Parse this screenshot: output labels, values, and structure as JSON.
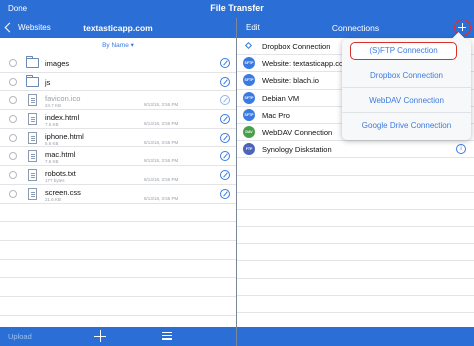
{
  "app": {
    "done_label": "Done",
    "title": "File Transfer"
  },
  "left_nav": {
    "back_label": "Websites",
    "site_title": "textasticapp.com"
  },
  "sort": {
    "label": "By Name ▾"
  },
  "files": [
    {
      "name": "images",
      "kind": "folder",
      "size": "",
      "date": ""
    },
    {
      "name": "js",
      "kind": "folder",
      "size": "",
      "date": ""
    },
    {
      "name": "favicon.ico",
      "kind": "file",
      "size": "24.7 KB",
      "date": "8/13/18, 3:55 PM",
      "dim": true
    },
    {
      "name": "index.html",
      "kind": "file",
      "size": "7.5 KB",
      "date": "8/13/18, 3:55 PM"
    },
    {
      "name": "iphone.html",
      "kind": "file",
      "size": "5.6 KB",
      "date": "8/13/18, 3:55 PM"
    },
    {
      "name": "mac.html",
      "kind": "file",
      "size": "7.6 KB",
      "date": "8/13/18, 3:55 PM"
    },
    {
      "name": "robots.txt",
      "kind": "file",
      "size": "177 bytes",
      "date": "8/13/18, 3:55 PM"
    },
    {
      "name": "screen.css",
      "kind": "file",
      "size": "21.6 KB",
      "date": "8/13/18, 3:55 PM"
    }
  ],
  "left_bottom": {
    "upload_label": "Upload"
  },
  "right_nav": {
    "edit_label": "Edit",
    "title": "Connections"
  },
  "connections": [
    {
      "label": "Dropbox Connection",
      "icon": "dropbox-icon",
      "badge": ""
    },
    {
      "label": "Website: textasticapp.com",
      "icon": "sftp-icon",
      "badge": "SFTP"
    },
    {
      "label": "Website: blach.io",
      "icon": "sftp-icon",
      "badge": "SFTP"
    },
    {
      "label": "Debian VM",
      "icon": "sftp-icon",
      "badge": "SFTP"
    },
    {
      "label": "Mac Pro",
      "icon": "sftp-icon",
      "badge": "SFTP"
    },
    {
      "label": "WebDAV Connection",
      "icon": "webdav-icon",
      "badge": "DAV"
    },
    {
      "label": "Synology Diskstation",
      "icon": "ftp-icon",
      "badge": "FTP"
    }
  ],
  "add_menu": {
    "options": [
      "(S)FTP Connection",
      "Dropbox Connection",
      "WebDAV Connection",
      "Google Drive Connection"
    ]
  },
  "colors": {
    "bar": "#2b6fd6",
    "accent": "#3b7ae0",
    "highlight": "#d9302a"
  }
}
